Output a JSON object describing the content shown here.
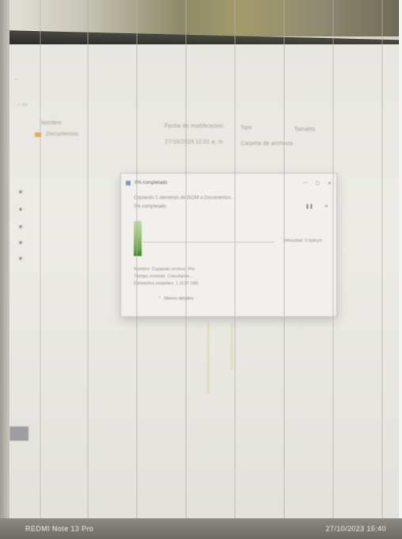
{
  "explorer": {
    "col_name": "Nombre",
    "col_date": "Fecha de modificación",
    "col_type": "Tipo",
    "col_size": "Tamaño",
    "folder_name": "Documentos",
    "folder_date": "27/10/2023 11:01 a. m.",
    "folder_type": "Carpeta de archivos"
  },
  "dialog": {
    "title": "0% completado",
    "copy_line": "Copiando 1 elemento de DCIM a Documentos",
    "status": "0% completado",
    "progress_percent": 0,
    "speed_label": "Velocidad: 0 bytes/s",
    "detail_name": "Nombre: Copiando archivo: Pol",
    "detail_time": "Tiempo restante: Calculando...",
    "detail_items": "Elementos restantes: 1 (0,97 GB)",
    "less_details": "Menos detalles"
  },
  "watermark": {
    "device": "REDMI Note 13 Pro",
    "timestamp": "27/10/2023 15:40"
  }
}
